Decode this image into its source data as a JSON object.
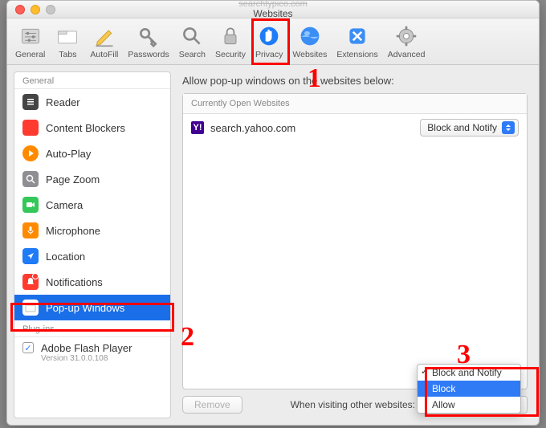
{
  "titlebar": {
    "context": "searchtypico.com",
    "title": "Websites"
  },
  "toolbar": [
    {
      "id": "general",
      "label": "General"
    },
    {
      "id": "tabs",
      "label": "Tabs"
    },
    {
      "id": "autofill",
      "label": "AutoFill"
    },
    {
      "id": "passwords",
      "label": "Passwords"
    },
    {
      "id": "search",
      "label": "Search"
    },
    {
      "id": "security",
      "label": "Security"
    },
    {
      "id": "privacy",
      "label": "Privacy"
    },
    {
      "id": "websites",
      "label": "Websites"
    },
    {
      "id": "extensions",
      "label": "Extensions"
    },
    {
      "id": "advanced",
      "label": "Advanced"
    }
  ],
  "sidebar": {
    "header_general": "General",
    "items": [
      {
        "label": "Reader"
      },
      {
        "label": "Content Blockers"
      },
      {
        "label": "Auto-Play"
      },
      {
        "label": "Page Zoom"
      },
      {
        "label": "Camera"
      },
      {
        "label": "Microphone"
      },
      {
        "label": "Location"
      },
      {
        "label": "Notifications"
      },
      {
        "label": "Pop-up Windows"
      }
    ],
    "header_plugins": "Plug-ins",
    "plugin": {
      "label": "Adobe Flash Player",
      "version": "Version 31.0.0.108"
    }
  },
  "main": {
    "title": "Allow pop-up windows on the websites below:",
    "section_header": "Currently Open Websites",
    "rows": [
      {
        "site": "search.yahoo.com",
        "setting": "Block and Notify"
      }
    ],
    "remove_label": "Remove",
    "other_label": "When visiting other websites:",
    "menu": {
      "options": [
        "Block and Notify",
        "Block",
        "Allow"
      ],
      "checked": "Block and Notify",
      "highlighted": "Block"
    }
  },
  "annotations": {
    "n1": "1",
    "n2": "2",
    "n3": "3"
  }
}
